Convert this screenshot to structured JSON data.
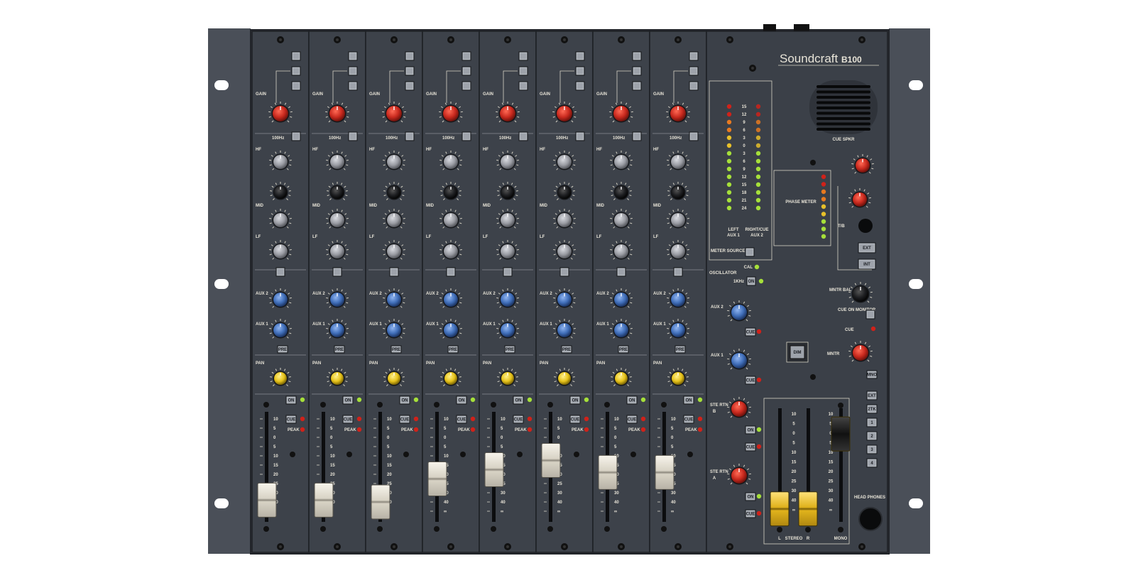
{
  "brand": {
    "name": "Soundcraft",
    "model": "B100"
  },
  "channel_count": 8,
  "channel_labels": {
    "gain": "GAIN",
    "hf": "HF",
    "mid": "MID",
    "lf": "LF",
    "aux2": "AUX 2",
    "aux1": "AUX 1",
    "pan": "PAN",
    "on": "ON",
    "cue": "CUE",
    "peak": "PEAK",
    "pre": "PRE",
    "filter": "100Hz"
  },
  "fader_scale": [
    "10",
    "5",
    "0",
    "5",
    "10",
    "15",
    "20",
    "25",
    "30",
    "40",
    "∞"
  ],
  "channel_fader_levels": [
    0.12,
    0.12,
    0.1,
    0.35,
    0.45,
    0.55,
    0.42,
    0.42
  ],
  "meter": {
    "scale": [
      "15",
      "12",
      "9",
      "6",
      "3",
      "0",
      "3",
      "6",
      "9",
      "12",
      "15",
      "18",
      "21",
      "24"
    ],
    "left_label": "LEFT",
    "left_sub": "AUX 1",
    "right_label": "RIGHT/CUE",
    "right_sub": "AUX 2",
    "source_label": "METER SOURCE"
  },
  "oscillator": {
    "label": "OSCILLATOR",
    "cal": "CAL",
    "freq": "1KHz",
    "on": "ON"
  },
  "master_aux": [
    {
      "label": "AUX 2"
    },
    {
      "label": "AUX 1"
    }
  ],
  "stereo_returns": [
    {
      "label": "STE RTN",
      "letter": "B"
    },
    {
      "label": "STE RTN",
      "letter": "A"
    }
  ],
  "cue_speaker": "CUE SPKR",
  "phase_meter": "PHASE METER",
  "talkback": "T/B",
  "ext": "EXT",
  "int": "INT",
  "monitor_bal": "MNTR BAL",
  "cue_on_monitor": "CUE ON MONITOR",
  "cue": "CUE",
  "dim": "DIM",
  "monitor": "MNTR",
  "mono_btn": "MNO",
  "source_buttons": [
    "EXT",
    "2TK",
    "1",
    "2",
    "3",
    "4"
  ],
  "stereo_label": "STEREO",
  "stereo_l": "L",
  "stereo_r": "R",
  "mono_label": "MONO",
  "headphones": "HEAD PHONES",
  "master_fader_levels": {
    "left": 0.08,
    "right": 0.08,
    "mono": 0.72
  },
  "colors": {
    "panel": "#3a3f47",
    "rack_ear": "#4a4f58",
    "gain_knob": "#c8291e",
    "eq_knob": "#9a9ca3",
    "mid_freq_knob": "#1e1f22",
    "aux_knob": "#3f6db8",
    "pan_knob": "#e6c21a",
    "fader_cap": "#e6e2d6",
    "master_fader_cap": "#e0b21c",
    "led_green": "#a6e03a",
    "led_yellow": "#e8c02a",
    "led_orange": "#e87a20",
    "led_red": "#d0221a"
  }
}
